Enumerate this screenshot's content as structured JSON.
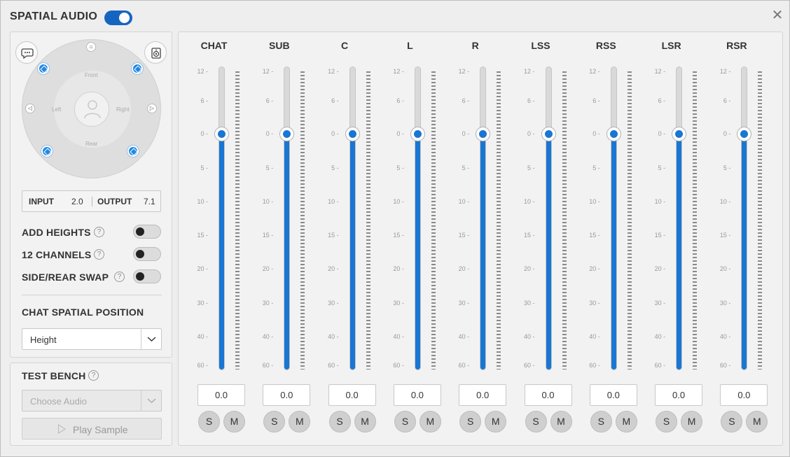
{
  "window": {
    "title": "SPATIAL AUDIO",
    "spatial_audio_enabled": true,
    "close_icon": "close-icon"
  },
  "speaker_map": {
    "labels": {
      "front": "Front",
      "left": "Left",
      "right": "Right",
      "rear": "Rear"
    },
    "chat_button_icon": "chat-bubble-icon",
    "speaker_button_icon": "speaker-icon"
  },
  "io": {
    "input_label": "INPUT",
    "input_value": "2.0",
    "output_label": "OUTPUT",
    "output_value": "7.1"
  },
  "options": [
    {
      "label": "ADD HEIGHTS",
      "enabled": false
    },
    {
      "label": "12 CHANNELS",
      "enabled": false
    },
    {
      "label": "SIDE/REAR SWAP",
      "enabled": false
    }
  ],
  "chat_position": {
    "label": "CHAT SPATIAL POSITION",
    "selected": "Height"
  },
  "test_bench": {
    "label": "TEST BENCH",
    "placeholder": "Choose Audio",
    "play_label": "Play Sample"
  },
  "scale_ticks": [
    "12 -",
    "6 -",
    "0 -",
    "5 -",
    "10 -",
    "15 -",
    "20 -",
    "30 -",
    "40 -",
    "60 -"
  ],
  "channels": [
    {
      "name": "CHAT",
      "value": "0.0",
      "solo": "S",
      "mute": "M"
    },
    {
      "name": "SUB",
      "value": "0.0",
      "solo": "S",
      "mute": "M"
    },
    {
      "name": "C",
      "value": "0.0",
      "solo": "S",
      "mute": "M"
    },
    {
      "name": "L",
      "value": "0.0",
      "solo": "S",
      "mute": "M"
    },
    {
      "name": "R",
      "value": "0.0",
      "solo": "S",
      "mute": "M"
    },
    {
      "name": "LSS",
      "value": "0.0",
      "solo": "S",
      "mute": "M"
    },
    {
      "name": "RSS",
      "value": "0.0",
      "solo": "S",
      "mute": "M"
    },
    {
      "name": "LSR",
      "value": "0.0",
      "solo": "S",
      "mute": "M"
    },
    {
      "name": "RSR",
      "value": "0.0",
      "solo": "S",
      "mute": "M"
    }
  ],
  "colors": {
    "accent": "#1976d2",
    "toggle_on": "#1565c0"
  }
}
